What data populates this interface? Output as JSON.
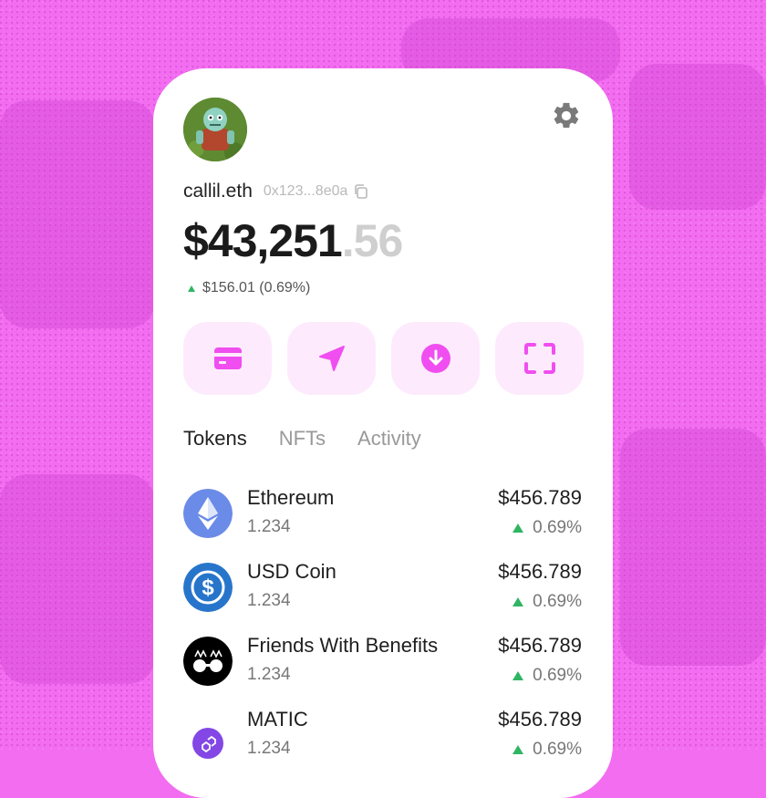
{
  "profile": {
    "ens_name": "callil.eth",
    "address": "0x123...8e0a"
  },
  "balance": {
    "dollars": "$43,251",
    "cents": ".56",
    "change": "$156.01 (0.69%)",
    "change_direction": "up"
  },
  "actions": [
    {
      "icon": "card-icon"
    },
    {
      "icon": "send-icon"
    },
    {
      "icon": "receive-icon"
    },
    {
      "icon": "scan-icon"
    }
  ],
  "tabs": [
    {
      "label": "Tokens",
      "active": true
    },
    {
      "label": "NFTs",
      "active": false
    },
    {
      "label": "Activity",
      "active": false
    }
  ],
  "tokens": [
    {
      "name": "Ethereum",
      "amount": "1.234",
      "value": "$456.789",
      "change": "0.69%",
      "icon": "ethereum-icon"
    },
    {
      "name": "USD Coin",
      "amount": "1.234",
      "value": "$456.789",
      "change": "0.69%",
      "icon": "usd-coin-icon"
    },
    {
      "name": "Friends With Benefits",
      "amount": "1.234",
      "value": "$456.789",
      "change": "0.69%",
      "icon": "fwb-icon"
    },
    {
      "name": "MATIC",
      "amount": "1.234",
      "value": "$456.789",
      "change": "0.69%",
      "icon": "matic-icon"
    }
  ],
  "colors": {
    "background": "#f26df0",
    "accent": "#f04ef0",
    "action_bg": "#fdebfd",
    "positive": "#2fb563"
  }
}
